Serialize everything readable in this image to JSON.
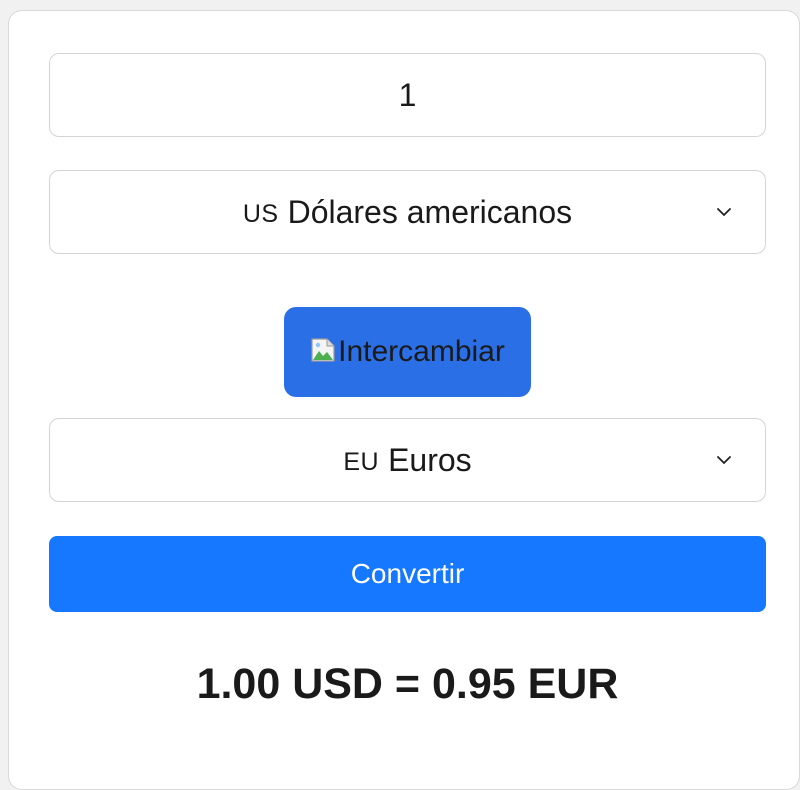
{
  "amount": {
    "value": "1"
  },
  "from_currency": {
    "code": "US",
    "label": "Dólares americanos"
  },
  "swap_button": {
    "label": "Intercambiar"
  },
  "to_currency": {
    "code": "EU",
    "label": "Euros"
  },
  "convert_button": {
    "label": "Convertir"
  },
  "result": {
    "text": "1.00 USD = 0.95 EUR"
  },
  "colors": {
    "swap_button_bg": "#2b6fe6",
    "convert_button_bg": "#1677ff",
    "text": "#1a1a1a"
  },
  "icons": {
    "select_arrow": "chevron-down-icon",
    "swap_image": "broken-image-icon"
  }
}
